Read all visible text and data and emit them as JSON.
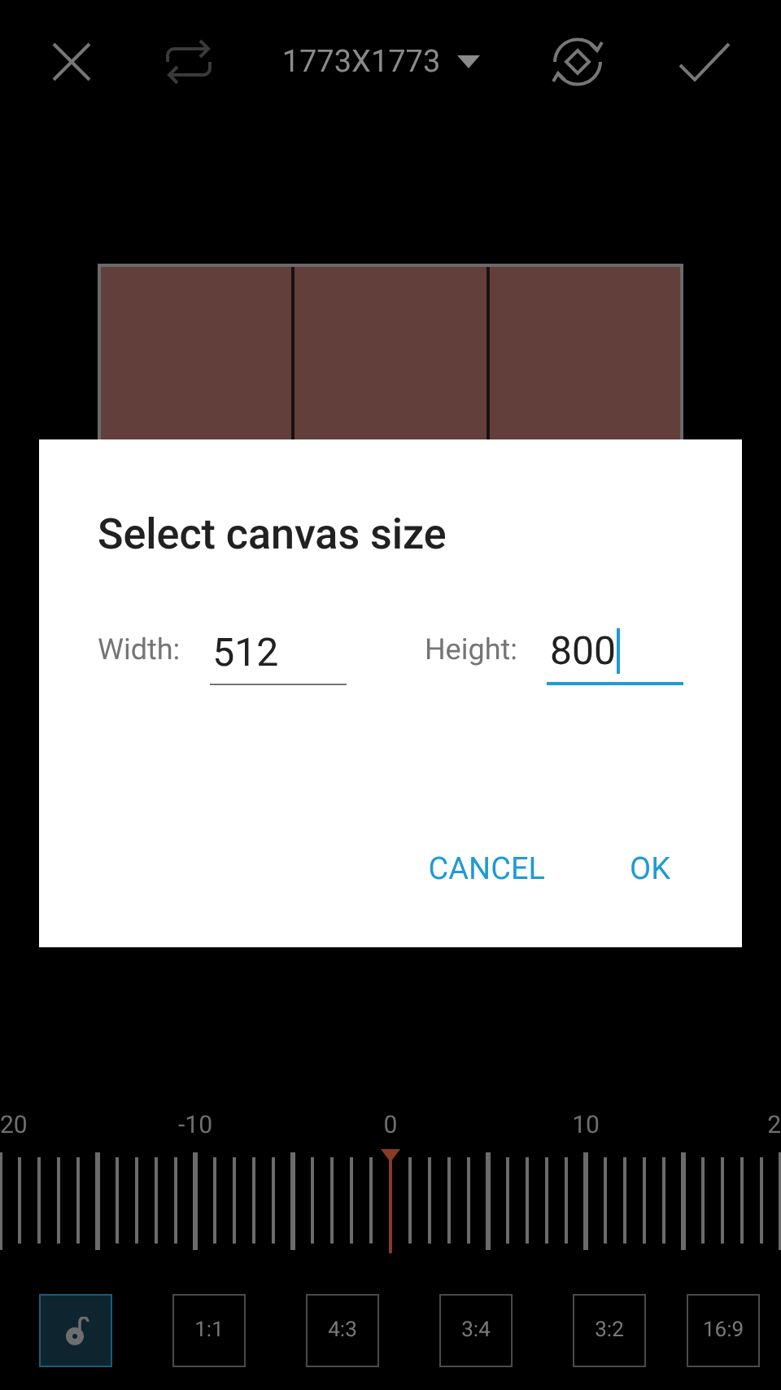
{
  "toolbar": {
    "size_label": "1773X1773"
  },
  "dialog": {
    "title": "Select canvas size",
    "fields": [
      {
        "label": "Width:",
        "value": "512",
        "focused": false
      },
      {
        "label": "Height:",
        "value": "800",
        "focused": true
      }
    ],
    "buttons": [
      "CANCEL",
      "OK"
    ]
  },
  "ruler": {
    "labels": [
      "20",
      "-10",
      "0",
      "10",
      "2"
    ]
  },
  "ratios": [
    {
      "kind": "lock",
      "selected": true
    },
    {
      "kind": "ratio",
      "label": "1:1",
      "selected": false
    },
    {
      "kind": "ratio",
      "label": "4:3",
      "selected": false
    },
    {
      "kind": "ratio",
      "label": "3:4",
      "selected": false
    },
    {
      "kind": "ratio",
      "label": "3:2",
      "selected": false
    },
    {
      "kind": "ratio",
      "label": "16:9",
      "selected": false
    }
  ]
}
